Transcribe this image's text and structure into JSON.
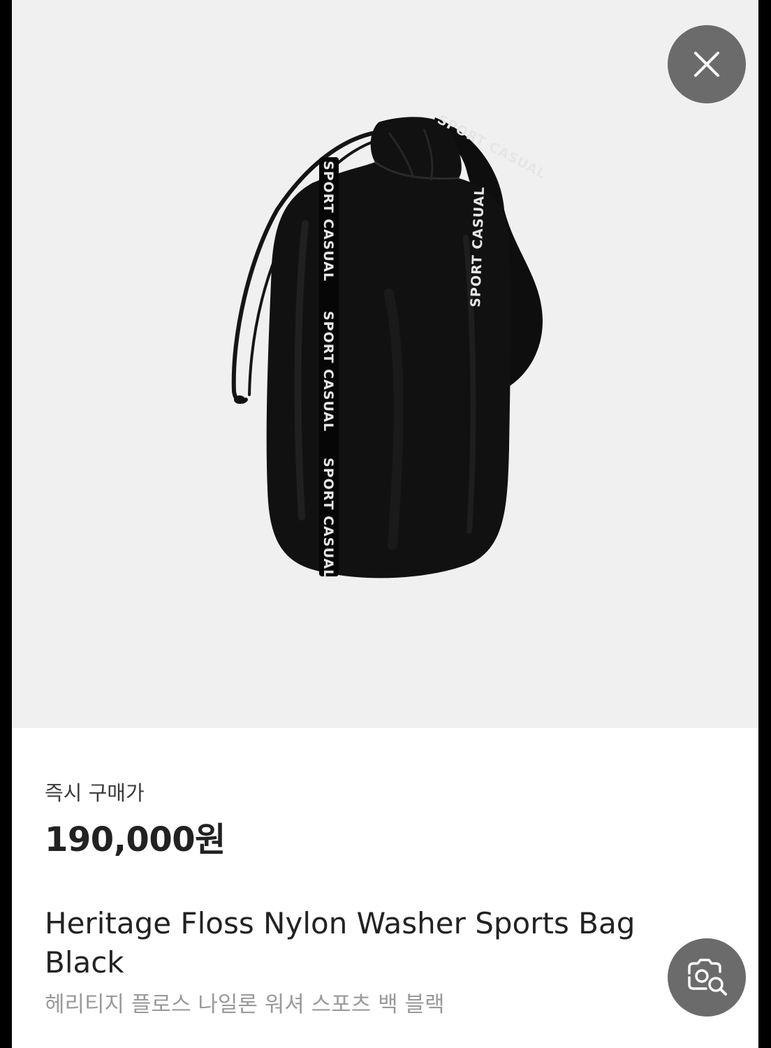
{
  "product": {
    "image_alt": "Heritage Floss Nylon Washer Sports Bag Black",
    "strap_text": "SPORT CASUAL",
    "price_label": "즉시 구매가",
    "price": "190,000원",
    "name_en": "Heritage Floss Nylon Washer Sports Bag Black",
    "name_ko": "헤리티지 플로스 나일론 워셔 스포츠 백 블랙"
  },
  "buttons": {
    "close": "close",
    "image_search": "image search"
  },
  "colors": {
    "image_background": "#f0f0f0",
    "button_background": "#6b6b6b",
    "price_text": "#222222",
    "subtitle_text": "#9a9a9a"
  }
}
